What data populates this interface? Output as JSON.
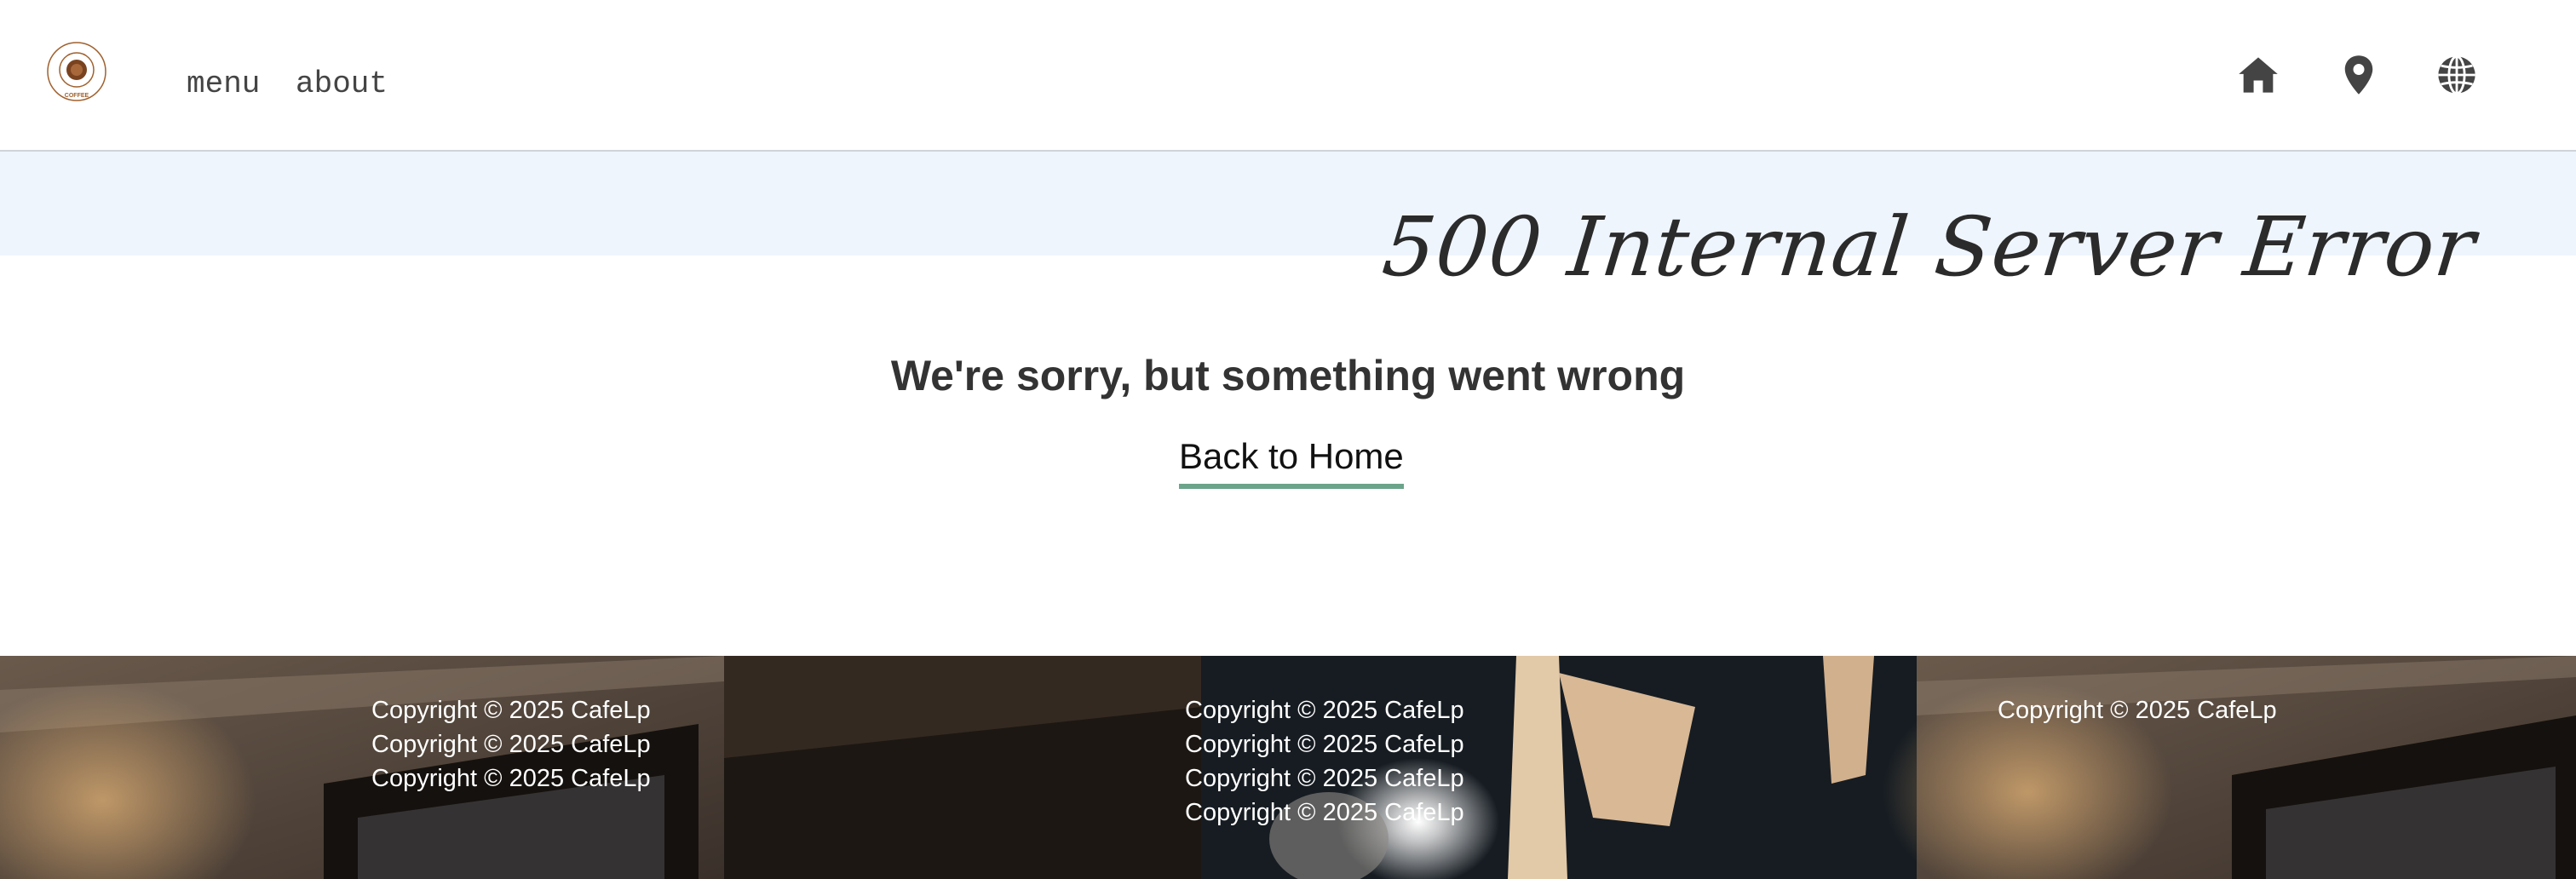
{
  "header": {
    "logo_text": "COFFEE",
    "nav": [
      {
        "label": "menu"
      },
      {
        "label": "about"
      }
    ],
    "icons": [
      "home-icon",
      "location-pin-icon",
      "globe-icon"
    ]
  },
  "error": {
    "title": "500 Internal Server Error",
    "message": "We're sorry, but something went wrong",
    "back_link": "Back to Home"
  },
  "footer": {
    "columns": [
      [
        "Copyright © 2025 CafeLp",
        "Copyright © 2025 CafeLp",
        "Copyright © 2025 CafeLp"
      ],
      [
        "Copyright © 2025 CafeLp",
        "Copyright © 2025 CafeLp",
        "Copyright © 2025 CafeLp",
        "Copyright © 2025 CafeLp"
      ],
      [
        "Copyright © 2025 CafeLp"
      ]
    ]
  },
  "colors": {
    "banner": "#eff5fd",
    "link_underline": "#6ba48a",
    "logo_accent": "#a0612e"
  }
}
